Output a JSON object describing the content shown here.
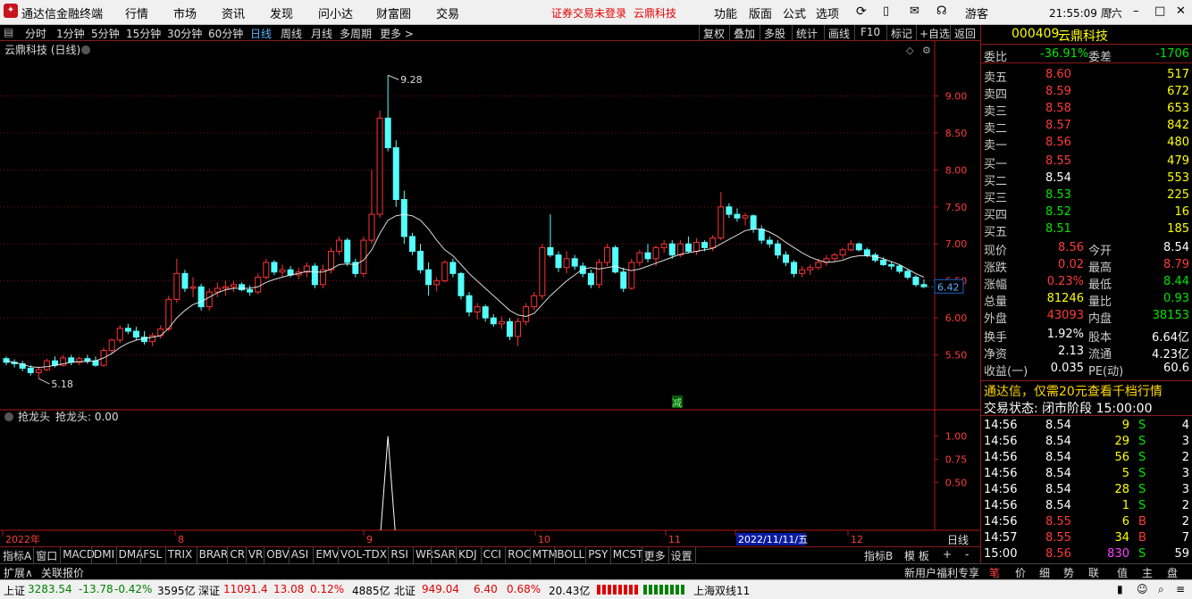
{
  "app": {
    "title": "通达信金融终端",
    "menu": [
      "行情",
      "市场",
      "资讯",
      "发现",
      "问小达",
      "财富圈",
      "交易"
    ],
    "notice": "证券交易未登录",
    "notice_stock": "云鼎科技",
    "right_menu": [
      "功能",
      "版面",
      "公式",
      "选项"
    ],
    "user": "游客",
    "clock": "21:55:09 周六"
  },
  "toolbar": {
    "periods": [
      "分时",
      "1分钟",
      "5分钟",
      "15分钟",
      "30分钟",
      "60分钟",
      "日线",
      "周线",
      "月线",
      "多周期",
      "更多 >"
    ],
    "active_period": "日线",
    "actions": [
      "复权",
      "叠加",
      "多股",
      "统计",
      "画线",
      "F10",
      "标记",
      "+自选",
      "返回"
    ]
  },
  "chart_header": {
    "title": "云鼎科技 (日线)"
  },
  "indicator_header": {
    "name": "抢龙头",
    "line": "抢龙头: 0.00"
  },
  "markers": {
    "high_label": "9.28",
    "low_label": "5.18",
    "last_label": "6.42",
    "event_label": "减"
  },
  "colors": {
    "up": "#ff3333",
    "down": "#54ffff",
    "grid": "#7a1010",
    "axis": "#b01818",
    "ma": "#ffffff"
  },
  "chart_data": {
    "type": "candlestick",
    "ylim": [
      5.0,
      9.5
    ],
    "y_ticks": [
      "9.00",
      "8.50",
      "8.00",
      "7.50",
      "7.00",
      "6.50",
      "6.00",
      "5.50"
    ],
    "x_labels": [
      "2022年",
      "8",
      "9",
      "10",
      "11",
      "2022/11/11/五",
      "12"
    ],
    "x_label_end": "日线",
    "ohlc": [
      [
        5.45,
        5.48,
        5.36,
        5.4
      ],
      [
        5.4,
        5.44,
        5.33,
        5.38
      ],
      [
        5.38,
        5.42,
        5.28,
        5.32
      ],
      [
        5.32,
        5.36,
        5.22,
        5.26
      ],
      [
        5.26,
        5.34,
        5.18,
        5.3
      ],
      [
        5.3,
        5.45,
        5.28,
        5.42
      ],
      [
        5.42,
        5.48,
        5.33,
        5.36
      ],
      [
        5.36,
        5.5,
        5.34,
        5.46
      ],
      [
        5.46,
        5.5,
        5.36,
        5.4
      ],
      [
        5.4,
        5.48,
        5.36,
        5.45
      ],
      [
        5.45,
        5.5,
        5.38,
        5.42
      ],
      [
        5.42,
        5.48,
        5.34,
        5.36
      ],
      [
        5.36,
        5.6,
        5.34,
        5.56
      ],
      [
        5.56,
        5.72,
        5.52,
        5.7
      ],
      [
        5.7,
        5.9,
        5.66,
        5.86
      ],
      [
        5.86,
        5.92,
        5.78,
        5.82
      ],
      [
        5.82,
        5.88,
        5.7,
        5.74
      ],
      [
        5.74,
        5.82,
        5.64,
        5.68
      ],
      [
        5.68,
        5.8,
        5.62,
        5.76
      ],
      [
        5.76,
        5.9,
        5.72,
        5.85
      ],
      [
        5.85,
        6.3,
        5.82,
        6.25
      ],
      [
        6.25,
        6.8,
        6.2,
        6.6
      ],
      [
        6.6,
        6.65,
        6.35,
        6.4
      ],
      [
        6.4,
        6.55,
        6.28,
        6.42
      ],
      [
        6.42,
        6.46,
        6.1,
        6.15
      ],
      [
        6.15,
        6.4,
        6.1,
        6.35
      ],
      [
        6.35,
        6.48,
        6.28,
        6.4
      ],
      [
        6.4,
        6.5,
        6.3,
        6.42
      ],
      [
        6.42,
        6.5,
        6.35,
        6.45
      ],
      [
        6.45,
        6.48,
        6.36,
        6.38
      ],
      [
        6.38,
        6.44,
        6.3,
        6.35
      ],
      [
        6.35,
        6.6,
        6.32,
        6.55
      ],
      [
        6.55,
        6.8,
        6.52,
        6.75
      ],
      [
        6.75,
        6.78,
        6.58,
        6.62
      ],
      [
        6.62,
        6.72,
        6.55,
        6.65
      ],
      [
        6.65,
        6.7,
        6.55,
        6.58
      ],
      [
        6.58,
        6.68,
        6.52,
        6.62
      ],
      [
        6.62,
        6.75,
        6.55,
        6.7
      ],
      [
        6.7,
        6.74,
        6.4,
        6.45
      ],
      [
        6.45,
        6.72,
        6.4,
        6.65
      ],
      [
        6.65,
        6.95,
        6.6,
        6.9
      ],
      [
        6.9,
        7.1,
        6.85,
        7.05
      ],
      [
        7.05,
        7.08,
        6.7,
        6.75
      ],
      [
        6.75,
        6.8,
        6.55,
        6.6
      ],
      [
        6.6,
        7.1,
        6.55,
        7.05
      ],
      [
        7.05,
        8.0,
        7.0,
        7.4
      ],
      [
        7.4,
        8.8,
        7.35,
        8.7
      ],
      [
        8.7,
        9.28,
        8.25,
        8.3
      ],
      [
        8.3,
        8.4,
        7.5,
        7.6
      ],
      [
        7.6,
        7.72,
        7.0,
        7.1
      ],
      [
        7.1,
        7.15,
        6.85,
        6.9
      ],
      [
        6.9,
        7.0,
        6.6,
        6.65
      ],
      [
        6.65,
        6.75,
        6.3,
        6.45
      ],
      [
        6.45,
        6.55,
        6.36,
        6.5
      ],
      [
        6.5,
        6.78,
        6.48,
        6.75
      ],
      [
        6.75,
        6.8,
        6.55,
        6.6
      ],
      [
        6.6,
        6.62,
        6.25,
        6.3
      ],
      [
        6.3,
        6.35,
        6.02,
        6.08
      ],
      [
        6.08,
        6.2,
        5.98,
        6.15
      ],
      [
        6.15,
        6.18,
        5.95,
        6.0
      ],
      [
        6.0,
        6.05,
        5.88,
        5.92
      ],
      [
        5.92,
        6.02,
        5.85,
        5.95
      ],
      [
        5.95,
        6.0,
        5.7,
        5.75
      ],
      [
        5.75,
        6.0,
        5.62,
        5.95
      ],
      [
        5.95,
        6.2,
        5.9,
        6.15
      ],
      [
        6.15,
        6.35,
        6.1,
        6.3
      ],
      [
        6.3,
        7.0,
        6.25,
        6.95
      ],
      [
        6.95,
        7.4,
        6.82,
        6.85
      ],
      [
        6.85,
        6.9,
        6.62,
        6.68
      ],
      [
        6.68,
        6.9,
        6.6,
        6.8
      ],
      [
        6.8,
        6.85,
        6.65,
        6.7
      ],
      [
        6.7,
        6.75,
        6.55,
        6.6
      ],
      [
        6.6,
        6.65,
        6.4,
        6.45
      ],
      [
        6.45,
        6.8,
        6.4,
        6.75
      ],
      [
        6.75,
        7.0,
        6.7,
        6.95
      ],
      [
        6.95,
        6.98,
        6.6,
        6.62
      ],
      [
        6.62,
        6.68,
        6.35,
        6.4
      ],
      [
        6.4,
        6.8,
        6.38,
        6.75
      ],
      [
        6.75,
        6.92,
        6.7,
        6.88
      ],
      [
        6.88,
        7.0,
        6.75,
        6.8
      ],
      [
        6.8,
        6.98,
        6.7,
        6.95
      ],
      [
        6.95,
        7.05,
        6.88,
        7.0
      ],
      [
        7.0,
        7.05,
        6.8,
        6.85
      ],
      [
        6.85,
        7.05,
        6.82,
        7.0
      ],
      [
        7.0,
        7.1,
        6.88,
        6.9
      ],
      [
        6.9,
        7.08,
        6.85,
        7.02
      ],
      [
        7.02,
        7.05,
        6.9,
        6.95
      ],
      [
        6.95,
        7.12,
        6.9,
        7.08
      ],
      [
        7.08,
        7.7,
        7.05,
        7.5
      ],
      [
        7.5,
        7.55,
        7.35,
        7.4
      ],
      [
        7.4,
        7.48,
        7.3,
        7.35
      ],
      [
        7.35,
        7.42,
        7.25,
        7.38
      ],
      [
        7.38,
        7.4,
        7.15,
        7.2
      ],
      [
        7.2,
        7.25,
        7.0,
        7.05
      ],
      [
        7.05,
        7.1,
        6.95,
        7.0
      ],
      [
        7.0,
        7.05,
        6.8,
        6.85
      ],
      [
        6.85,
        6.9,
        6.7,
        6.75
      ],
      [
        6.75,
        6.78,
        6.55,
        6.6
      ],
      [
        6.6,
        6.7,
        6.55,
        6.65
      ],
      [
        6.65,
        6.72,
        6.58,
        6.68
      ],
      [
        6.68,
        6.8,
        6.65,
        6.75
      ],
      [
        6.75,
        6.85,
        6.7,
        6.8
      ],
      [
        6.8,
        6.88,
        6.75,
        6.85
      ],
      [
        6.85,
        6.95,
        6.8,
        6.92
      ],
      [
        6.92,
        7.05,
        6.9,
        7.0
      ],
      [
        7.0,
        7.02,
        6.9,
        6.92
      ],
      [
        6.92,
        6.95,
        6.82,
        6.85
      ],
      [
        6.85,
        6.88,
        6.75,
        6.78
      ],
      [
        6.78,
        6.82,
        6.7,
        6.72
      ],
      [
        6.72,
        6.76,
        6.65,
        6.7
      ],
      [
        6.7,
        6.72,
        6.6,
        6.63
      ],
      [
        6.63,
        6.66,
        6.52,
        6.55
      ],
      [
        6.55,
        6.58,
        6.42,
        6.45
      ],
      [
        6.45,
        6.52,
        6.4,
        6.42
      ]
    ],
    "ma": [
      5.42,
      5.4,
      5.37,
      5.34,
      5.33,
      5.34,
      5.36,
      5.38,
      5.4,
      5.41,
      5.41,
      5.42,
      5.46,
      5.52,
      5.6,
      5.66,
      5.7,
      5.72,
      5.74,
      5.76,
      5.86,
      6.0,
      6.1,
      6.18,
      6.22,
      6.28,
      6.34,
      6.38,
      6.4,
      6.4,
      6.4,
      6.42,
      6.48,
      6.52,
      6.55,
      6.58,
      6.6,
      6.63,
      6.62,
      6.62,
      6.66,
      6.72,
      6.73,
      6.72,
      6.78,
      6.92,
      7.14,
      7.32,
      7.38,
      7.4,
      7.38,
      7.32,
      7.2,
      7.05,
      6.92,
      6.84,
      6.72,
      6.6,
      6.5,
      6.4,
      6.3,
      6.2,
      6.1,
      6.04,
      6.02,
      6.06,
      6.18,
      6.3,
      6.4,
      6.5,
      6.58,
      6.66,
      6.68,
      6.66,
      6.68,
      6.7,
      6.66,
      6.64,
      6.66,
      6.7,
      6.74,
      6.78,
      6.82,
      6.86,
      6.88,
      6.9,
      6.92,
      6.94,
      7.0,
      7.06,
      7.12,
      7.18,
      7.2,
      7.2,
      7.16,
      7.1,
      7.02,
      6.95,
      6.88,
      6.82,
      6.78,
      6.75,
      6.76,
      6.78,
      6.82,
      6.84,
      6.84,
      6.83,
      6.8,
      6.76,
      6.72,
      6.66,
      6.6,
      6.55
    ],
    "indicator": {
      "name": "抢龙头",
      "ylim": [
        0,
        1.2
      ],
      "y_ticks": [
        "1.00",
        "0.75",
        "0.50"
      ],
      "spike_index": 47,
      "spike_value": 1.0
    }
  },
  "quote": {
    "code": "000409",
    "name": "云鼎科技",
    "webi_label": "委比",
    "webi_value": "-36.91%",
    "weicha_label": "委差",
    "weicha_value": "-1706",
    "asks": [
      [
        "卖五",
        "8.60",
        "517"
      ],
      [
        "卖四",
        "8.59",
        "672"
      ],
      [
        "卖三",
        "8.58",
        "653"
      ],
      [
        "卖二",
        "8.57",
        "842"
      ],
      [
        "卖一",
        "8.56",
        "480"
      ]
    ],
    "bids": [
      [
        "买一",
        "8.55",
        "479"
      ],
      [
        "买二",
        "8.54",
        "553"
      ],
      [
        "买三",
        "8.53",
        "225"
      ],
      [
        "买四",
        "8.52",
        "16"
      ],
      [
        "买五",
        "8.51",
        "185"
      ]
    ],
    "stats": [
      [
        "现价",
        "8.56",
        "今开",
        "8.54"
      ],
      [
        "涨跌",
        "0.02",
        "最高",
        "8.79"
      ],
      [
        "涨幅",
        "0.23%",
        "最低",
        "8.44"
      ],
      [
        "总量",
        "81246",
        "量比",
        "0.93"
      ],
      [
        "外盘",
        "43093",
        "内盘",
        "38153"
      ]
    ],
    "stats2": [
      [
        "换手",
        "1.92%",
        "股本",
        "6.64亿"
      ],
      [
        "净资",
        "2.13",
        "流通",
        "4.23亿"
      ],
      [
        "收益(一)",
        "0.035",
        "PE(动)",
        "60.6"
      ]
    ],
    "promo": "通达信，仅需20元查看千档行情",
    "trade_status": "交易状态: 闭市阶段 15:00:00",
    "ticks": [
      [
        "14:56",
        "8.54",
        "9",
        "S",
        "4"
      ],
      [
        "14:56",
        "8.54",
        "29",
        "S",
        "3"
      ],
      [
        "14:56",
        "8.54",
        "56",
        "S",
        "2"
      ],
      [
        "14:56",
        "8.54",
        "5",
        "S",
        "3"
      ],
      [
        "14:56",
        "8.54",
        "28",
        "S",
        "3"
      ],
      [
        "14:56",
        "8.54",
        "1",
        "S",
        "2"
      ],
      [
        "14:56",
        "8.55",
        "6",
        "B",
        "2"
      ],
      [
        "14:57",
        "8.55",
        "34",
        "B",
        "7"
      ],
      [
        "15:00",
        "8.56",
        "830",
        "S",
        "59"
      ]
    ]
  },
  "indicator_bar": {
    "items": [
      "指标A",
      "窗口",
      "MACD",
      "DMI",
      "DMA",
      "FSL",
      "TRIX",
      "BRAR",
      "CR",
      "VR",
      "OBV",
      "ASI",
      "EMV",
      "VOL-TDX",
      "RSI",
      "WR",
      "SAR",
      "KDJ",
      "CCI",
      "ROC",
      "MTM",
      "BOLL",
      "PSY",
      "MCST",
      "更多",
      "设置"
    ],
    "right": [
      "指标B",
      "模 板",
      "+",
      "-"
    ]
  },
  "ext_bar": {
    "items": [
      "扩展∧",
      "关联报价"
    ],
    "right_promo": "新用户福利专享",
    "tabs": [
      "笔",
      "价",
      "细",
      "势",
      "联",
      "值",
      "主",
      "盘"
    ]
  },
  "status_bar": {
    "sh_label": "上证",
    "sh_value": "3283.54",
    "sh_change": "-13.78",
    "sh_pct": "-0.42%",
    "sh_amount": "3595亿",
    "sz_label": "深证",
    "sz_value": "11091.4",
    "sz_change": "13.08",
    "sz_pct": "0.12%",
    "sz_amount": "4885亿",
    "bz_label": "北证",
    "bz_value": "949.04",
    "bz_change": "6.40",
    "bz_pct": "0.68%",
    "bz_amount": "20.43亿",
    "line": "上海双线11"
  }
}
